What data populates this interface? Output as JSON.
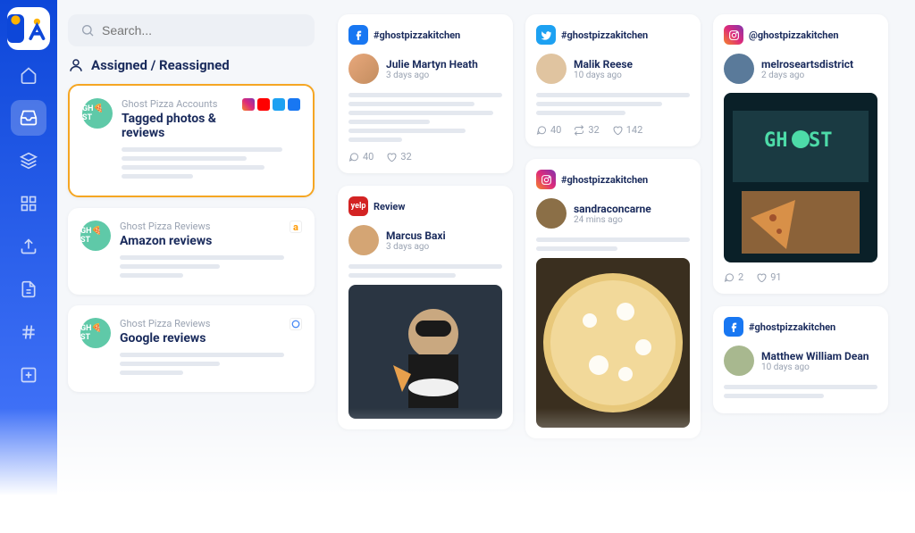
{
  "search": {
    "placeholder": "Search..."
  },
  "section_title": "Assigned / Reassigned",
  "streams": [
    {
      "avatar_text": "GH🍕ST",
      "meta": "Ghost Pizza Accounts",
      "title": "Tagged photos & reviews",
      "icons": [
        "ig",
        "yt",
        "tw",
        "fb"
      ],
      "selected": true
    },
    {
      "avatar_text": "GH🍕ST",
      "meta": "Ghost Pizza Reviews",
      "title": "Amazon reviews",
      "icons": [
        "am"
      ],
      "selected": false
    },
    {
      "avatar_text": "GH🍕ST",
      "meta": "Ghost Pizza Reviews",
      "title": "Google reviews",
      "icons": [
        "go"
      ],
      "selected": false
    }
  ],
  "columns": [
    [
      {
        "platform": "fb",
        "hashtag": "#ghostpizzakitchen",
        "author": "Julie Martyn Heath",
        "time": "3 days ago",
        "avatar_bg": "linear-gradient(135deg,#e8a87c,#c38d5f)",
        "lines": [
          170,
          140,
          160,
          90,
          130,
          60
        ],
        "comments": "40",
        "likes": "32"
      },
      {
        "platform": "yelp",
        "label": "Review",
        "author": "Marcus Baxi",
        "time": "3 days ago",
        "avatar_bg": "#d4a574",
        "lines": [
          170,
          120
        ],
        "image": "pizza-guy"
      }
    ],
    [
      {
        "platform": "tw",
        "hashtag": "#ghostpizzakitchen",
        "author": "Malik Reese",
        "time": "10 days ago",
        "avatar_bg": "#e0c4a0",
        "lines": [
          170,
          140,
          100
        ],
        "comments": "40",
        "reposts": "32",
        "likes": "142"
      },
      {
        "platform": "ig",
        "hashtag": "#ghostpizzakitchen",
        "author": "sandraconcarne",
        "time": "24 mins ago",
        "avatar_bg": "#8b6f47",
        "lines": [
          170,
          90
        ],
        "image": "cheese-pizza"
      }
    ],
    [
      {
        "platform": "ig",
        "hashtag": "@ghostpizzakitchen",
        "author": "melroseartsdistrict",
        "time": "2 days ago",
        "avatar_bg": "#5a7a9a",
        "lines": [],
        "image": "ghost-store",
        "comments": "2",
        "likes": "91"
      },
      {
        "platform": "fb",
        "hashtag": "#ghostpizzakitchen",
        "author": "Matthew William Dean",
        "time": "10 days ago",
        "avatar_bg": "#a8b88f",
        "lines": [
          170,
          110
        ]
      }
    ]
  ]
}
